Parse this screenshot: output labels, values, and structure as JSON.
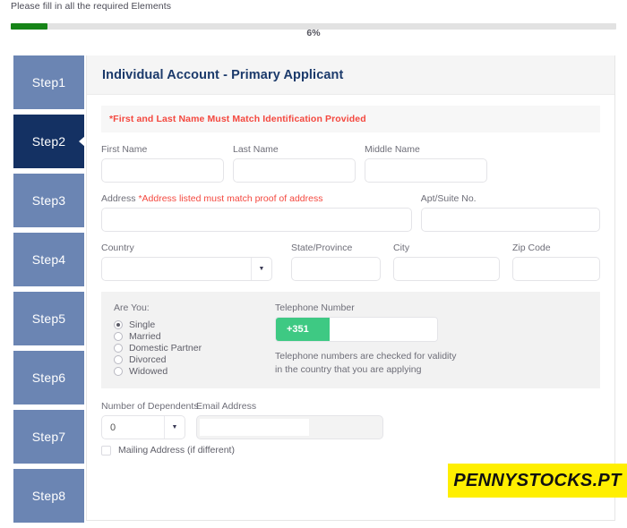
{
  "top_notice": "Please fill in all the required Elements",
  "progress": {
    "percent_label": "6%",
    "percent_value": 6,
    "fill_color": "#168417",
    "track_color": "#e2e2e2"
  },
  "sidebar": {
    "active_index": 1,
    "active_color": "#143163",
    "inactive_color": "#6b85b3",
    "items": [
      {
        "label": "Step1"
      },
      {
        "label": "Step2"
      },
      {
        "label": "Step3"
      },
      {
        "label": "Step4"
      },
      {
        "label": "Step5"
      },
      {
        "label": "Step6"
      },
      {
        "label": "Step7"
      },
      {
        "label": "Step8"
      }
    ]
  },
  "panel": {
    "title": "Individual Account - Primary Applicant",
    "title_color": "#1b3a6b",
    "alert": {
      "text": "*First and Last Name Must Match Identification Provided",
      "color": "#f4483f"
    },
    "name_row": {
      "first_name": {
        "label": "First Name",
        "value": "",
        "placeholder": ""
      },
      "last_name": {
        "label": "Last Name",
        "value": "",
        "placeholder": ""
      },
      "middle_name": {
        "label": "Middle Name",
        "value": "",
        "placeholder": ""
      }
    },
    "address_row": {
      "address": {
        "label": "Address",
        "required_note": "*Address listed must match proof of address",
        "value": "",
        "placeholder": ""
      },
      "apt": {
        "label": "Apt/Suite No.",
        "value": "",
        "placeholder": ""
      }
    },
    "location_row": {
      "country": {
        "label": "Country",
        "value": "",
        "arrow": "chevron-down-icon"
      },
      "state": {
        "label": "State/Province",
        "value": "",
        "placeholder": ""
      },
      "city": {
        "label": "City",
        "value": "",
        "placeholder": ""
      },
      "zip": {
        "label": "Zip Code",
        "value": "",
        "placeholder": ""
      }
    },
    "status_block": {
      "are_you_label": "Are You:",
      "options": [
        {
          "label": "Single",
          "selected": true
        },
        {
          "label": "Married",
          "selected": false
        },
        {
          "label": "Domestic Partner",
          "selected": false
        },
        {
          "label": "Divorced",
          "selected": false
        },
        {
          "label": "Widowed",
          "selected": false
        }
      ],
      "telephone": {
        "label": "Telephone Number",
        "prefix": "+351",
        "prefix_color": "#3ec983",
        "value": "",
        "note_line1": "Telephone numbers are checked for validity in",
        "note_line2": "the country that you are applying"
      }
    },
    "bottom_row": {
      "dependents": {
        "label": "Number of Dependents",
        "value": "0",
        "arrow": "chevron-down-icon"
      },
      "email": {
        "label": "Email Address",
        "value": "",
        "placeholder": ""
      }
    },
    "mailing_checkbox": {
      "label": "Mailing Address (if different)",
      "checked": false
    }
  },
  "watermark": {
    "text": "PENNYSTOCKS.PT",
    "background": "#ffef00",
    "text_color": "#111111"
  }
}
